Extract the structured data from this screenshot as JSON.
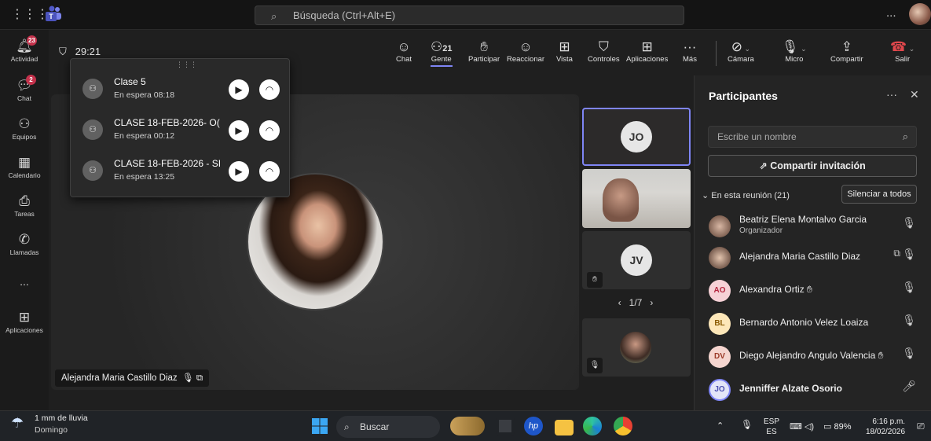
{
  "topbar": {
    "search_placeholder": "Búsqueda (Ctrl+Alt+E)",
    "more": "..."
  },
  "rail": {
    "items": [
      {
        "label": "Actividad",
        "icon": "bell-icon",
        "badge": "23"
      },
      {
        "label": "Chat",
        "icon": "chat-icon",
        "badge": "2"
      },
      {
        "label": "Equipos",
        "icon": "teams-icon",
        "badge": ""
      },
      {
        "label": "Calendario",
        "icon": "calendar-icon",
        "badge": ""
      },
      {
        "label": "Tareas",
        "icon": "tasks-icon",
        "badge": ""
      },
      {
        "label": "Llamadas",
        "icon": "phone-icon",
        "badge": ""
      },
      {
        "label": "...",
        "icon": "more-icon",
        "badge": ""
      },
      {
        "label": "Aplicaciones",
        "icon": "apps-icon",
        "badge": ""
      }
    ]
  },
  "meeting": {
    "timer": "29:21",
    "toolbar": {
      "chat": "Chat",
      "people": "Gente",
      "people_count": "21",
      "raise": "Participar",
      "react": "Reaccionar",
      "view": "Vista",
      "controls": "Controles",
      "apps": "Aplicaciones",
      "more": "Más",
      "camera": "Cámara",
      "mic": "Micro",
      "share": "Compartir",
      "leave": "Salir"
    },
    "on_hold": [
      {
        "title": "Clase 5",
        "status": "En espera 08:18"
      },
      {
        "title": "CLASE 18-FEB-2026- O(",
        "status": "En espera 00:12"
      },
      {
        "title": "CLASE 18-FEB-2026 - SI",
        "status": "En espera 13:25"
      }
    ],
    "main_speaker": "Alejandra Maria Castillo Diaz",
    "thumbnails": [
      "JO",
      "",
      "JV",
      ""
    ],
    "pager": "1/7"
  },
  "panel": {
    "title": "Participantes",
    "search_placeholder": "Escribe un nombre",
    "invite": "Compartir invitación",
    "in_meeting": "En esta reunión (21)",
    "mute_all": "Silenciar a todos",
    "people": [
      {
        "initials": "",
        "name": "Beatriz Elena Montalvo Garcia",
        "role": "Organizador",
        "color": "#6b4c3b"
      },
      {
        "initials": "",
        "name": "Alejandra Maria Castillo Diaz",
        "role": "",
        "color": "#8a6a5a"
      },
      {
        "initials": "AO",
        "name": "Alexandra Ortiz",
        "role": "",
        "color": "#f6d1d6"
      },
      {
        "initials": "BL",
        "name": "Bernardo Antonio Velez Loaiza",
        "role": "",
        "color": "#fde7b9"
      },
      {
        "initials": "DV",
        "name": "Diego Alejandro Angulo Valencia",
        "role": "",
        "color": "#f5d5cf"
      },
      {
        "initials": "JO",
        "name": "Jenniffer Alzate Osorio",
        "role": "",
        "color": "#e3e5f8"
      }
    ]
  },
  "taskbar": {
    "weather_title": "1 mm de lluvia",
    "weather_sub": "Domingo",
    "search": "Buscar",
    "lang1": "ESP",
    "lang2": "ES",
    "battery": "89%",
    "time": "6:16 p.m.",
    "date": "18/02/2026"
  }
}
